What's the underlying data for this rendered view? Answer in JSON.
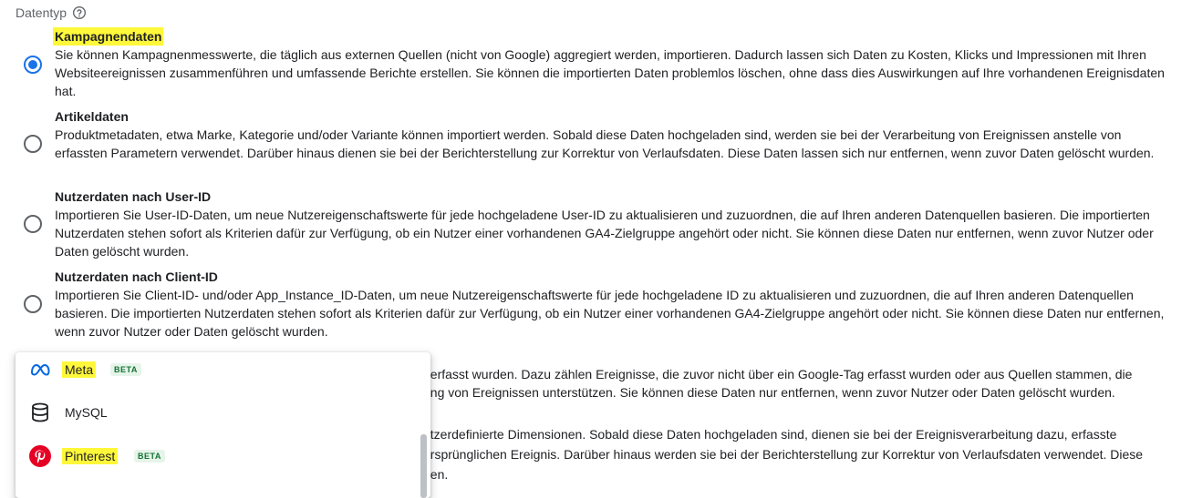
{
  "header": {
    "label": "Datentyp",
    "help_icon": "help-circle-icon"
  },
  "options": [
    {
      "title": "Kampagnendaten",
      "selected": true,
      "highlighted": true,
      "description": "Sie können Kampagnenmesswerte, die täglich aus externen Quellen (nicht von Google) aggregiert werden, importieren. Dadurch lassen sich Daten zu Kosten, Klicks und Impressionen mit Ihren Websiteereignissen zusammenführen und umfassende Berichte erstellen. Sie können die importierten Daten problemlos löschen, ohne dass dies Auswirkungen auf Ihre vorhandenen Ereignisdaten hat."
    },
    {
      "title": "Artikeldaten",
      "selected": false,
      "description": "Produktmetadaten, etwa Marke, Kategorie und/oder Variante können importiert werden. Sobald diese Daten hochgeladen sind, werden sie bei der Verarbeitung von Ereignissen anstelle von erfassten Parametern verwendet. Darüber hinaus dienen sie bei der Berichterstellung zur Korrektur von Verlaufsdaten. Diese Daten lassen sich nur entfernen, wenn zuvor Daten gelöscht wurden."
    },
    {
      "title": "Nutzerdaten nach User-ID",
      "selected": false,
      "description": "Importieren Sie User-ID-Daten, um neue Nutzereigenschaftswerte für jede hochgeladene User-ID zu aktualisieren und zuzuordnen, die auf Ihren anderen Datenquellen basieren. Die importierten Nutzerdaten stehen sofort als Kriterien dafür zur Verfügung, ob ein Nutzer einer vorhandenen GA4-Zielgruppe angehört oder nicht. Sie können diese Daten nur entfernen, wenn zuvor Nutzer oder Daten gelöscht wurden."
    },
    {
      "title": "Nutzerdaten nach Client-ID",
      "selected": false,
      "description": "Importieren Sie Client-ID- und/oder App_Instance_ID-Daten, um neue Nutzereigenschaftswerte für jede hochgeladene ID zu aktualisieren und zuzuordnen, die auf Ihren anderen Datenquellen basieren. Die importierten Nutzerdaten stehen sofort als Kriterien dafür zur Verfügung, ob ein Nutzer einer vorhandenen GA4-Zielgruppe angehört oder nicht. Sie können diese Daten nur entfernen, wenn zuvor Nutzer oder Daten gelöscht wurden."
    }
  ],
  "occluded_text": {
    "line1": "t erfasst wurden. Dazu zählen Ereignisse, die zuvor nicht über ein Google-Tag erfasst wurden oder aus Quellen stammen, die",
    "line2": "ung von Ereignissen unterstützen. Sie können diese Daten nur entfernen, wenn zuvor Nutzer oder Daten gelöscht wurden.",
    "line3": "utzerdefinierte Dimensionen. Sobald diese Daten hochgeladen sind, dienen sie bei der Ereignisverarbeitung dazu, erfasste",
    "line4": "ursprünglichen Ereignis. Darüber hinaus werden sie bei der Berichterstellung zur Korrektur von Verlaufsdaten verwendet. Diese",
    "line5": "den."
  },
  "menu": {
    "items": [
      {
        "label": "Meta",
        "icon": "meta-logo-icon",
        "badge": "BETA",
        "highlighted": true
      },
      {
        "label": "MySQL",
        "icon": "database-icon",
        "badge": "",
        "highlighted": false
      },
      {
        "label": "Pinterest",
        "icon": "pinterest-logo-icon",
        "badge": "BETA",
        "highlighted": true
      }
    ]
  },
  "colors": {
    "accent": "#1a73e8",
    "highlight": "#fff83a",
    "beta_text": "#137333",
    "beta_bg": "#e6f4ea",
    "pinterest": "#e60023",
    "meta": "#0668e1"
  }
}
